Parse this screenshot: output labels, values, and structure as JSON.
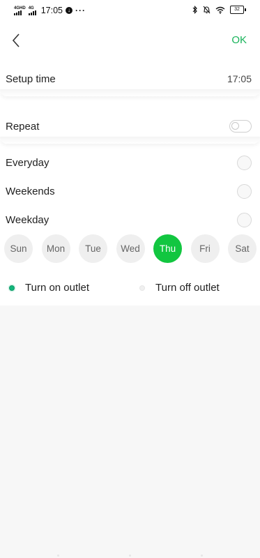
{
  "status_bar": {
    "network_1": "4G",
    "network_1_sup": "HD",
    "network_2": "4G",
    "time": "17:05",
    "more": "···",
    "battery": "32"
  },
  "header": {
    "ok_label": "OK"
  },
  "setup_time": {
    "label": "Setup time",
    "value": "17:05"
  },
  "repeat": {
    "label": "Repeat",
    "enabled": false
  },
  "repeat_options": [
    {
      "label": "Everyday",
      "selected": false
    },
    {
      "label": "Weekends",
      "selected": false
    },
    {
      "label": "Weekday",
      "selected": false
    }
  ],
  "days": [
    {
      "label": "Sun",
      "selected": false
    },
    {
      "label": "Mon",
      "selected": false
    },
    {
      "label": "Tue",
      "selected": false
    },
    {
      "label": "Wed",
      "selected": false
    },
    {
      "label": "Thu",
      "selected": true
    },
    {
      "label": "Fri",
      "selected": false
    },
    {
      "label": "Sat",
      "selected": false
    }
  ],
  "outlet_actions": [
    {
      "label": "Turn on outlet",
      "selected": true
    },
    {
      "label": "Turn off outlet",
      "selected": false
    }
  ],
  "colors": {
    "accent": "#12c640",
    "ok_text": "#18b35a",
    "radio_selected": "#12b67b"
  },
  "icons": {
    "back": "chevron-left-icon",
    "bluetooth": "bluetooth-icon",
    "mute": "bell-off-icon",
    "wifi": "wifi-icon",
    "battery": "battery-icon",
    "download": "download-icon"
  }
}
